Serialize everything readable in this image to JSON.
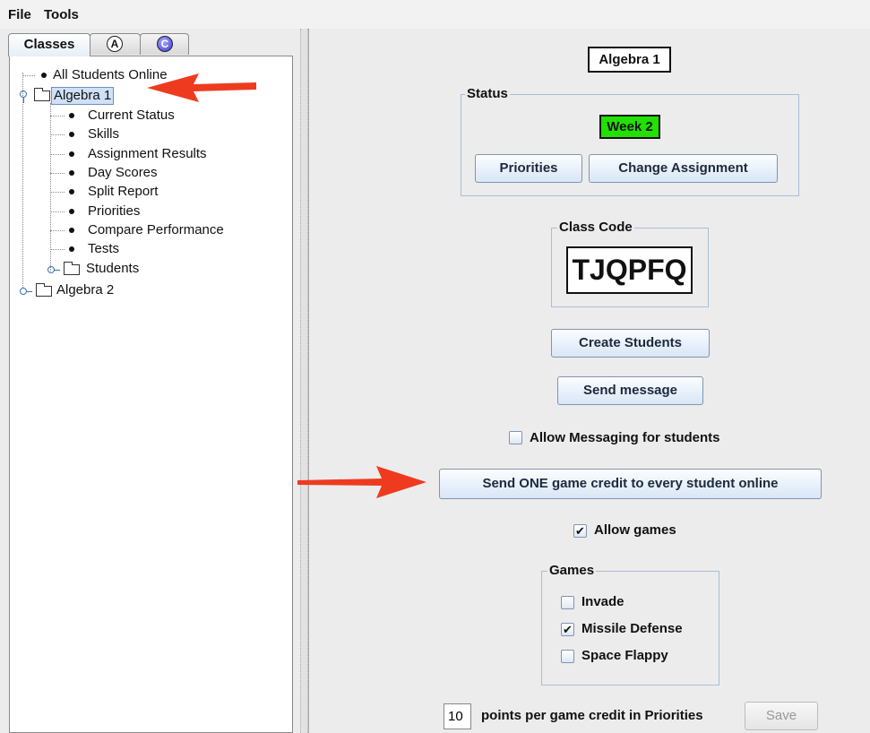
{
  "menu": {
    "file": "File",
    "tools": "Tools"
  },
  "left_tabs": {
    "classes": "Classes",
    "a": "A",
    "c": "C"
  },
  "tree": {
    "all_students_online": "All Students Online",
    "algebra1": "Algebra 1",
    "algebra1_children": [
      "Current Status",
      "Skills",
      "Assignment Results",
      "Day Scores",
      "Split Report",
      "Priorities",
      "Compare Performance",
      "Tests"
    ],
    "students": "Students",
    "algebra2": "Algebra 2"
  },
  "main": {
    "class_title": "Algebra 1",
    "status_legend": "Status",
    "week_badge": "Week 2",
    "week_badge_color": "#22e000",
    "priorities_button": "Priorities",
    "change_assignment_button": "Change Assignment",
    "class_code_legend": "Class Code",
    "class_code": "TJQPFQ",
    "create_students_button": "Create Students",
    "send_message_button": "Send message",
    "allow_messaging_label": "Allow Messaging for students",
    "allow_messaging_checked": false,
    "send_credit_button": "Send ONE game credit to every student online",
    "allow_games_label": "Allow games",
    "allow_games_checked": true,
    "games_legend": "Games",
    "games": [
      {
        "label": "Invade",
        "checked": false
      },
      {
        "label": "Missile Defense",
        "checked": true
      },
      {
        "label": "Space Flappy",
        "checked": false
      }
    ],
    "points_value": "10",
    "points_label": "points per game credit in Priorities",
    "save_button": "Save"
  },
  "annotation_color": "#ee3b1f"
}
